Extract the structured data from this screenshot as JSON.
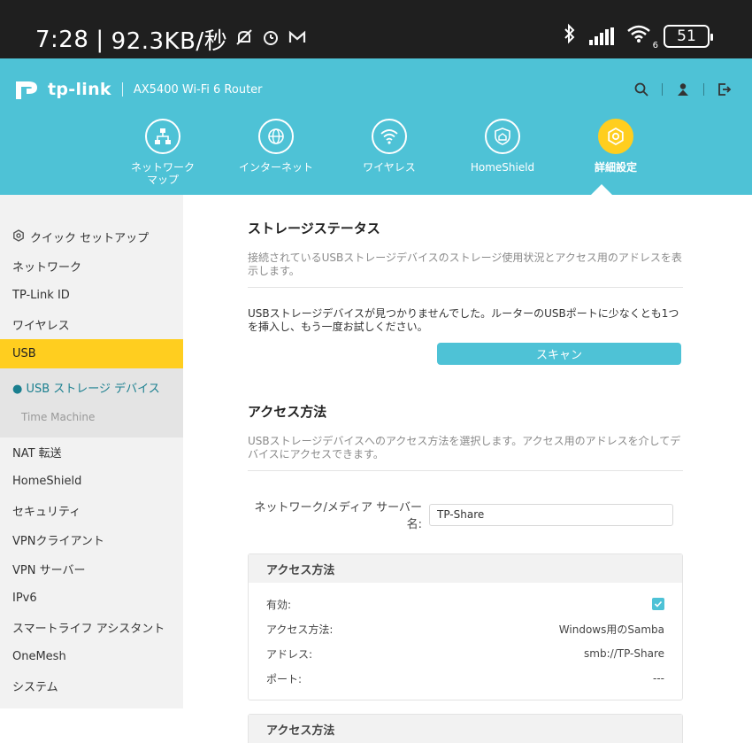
{
  "status_bar": {
    "time": "7:28",
    "speed": "92.3KB/秒",
    "battery": "51",
    "wifi_badge": "6",
    "icons": [
      "mute-icon",
      "alarm-icon",
      "mail-icon",
      "bluetooth-icon",
      "signal-icon",
      "wifi-icon",
      "battery-icon"
    ]
  },
  "header": {
    "brand": "tp-link",
    "model": "AX5400 Wi-Fi 6 Router",
    "icons": [
      "search-icon",
      "account-icon",
      "logout-icon"
    ],
    "nav": [
      {
        "label": "ネットワーク\nマップ",
        "icon": "network-map-icon"
      },
      {
        "label": "インターネット",
        "icon": "globe-icon"
      },
      {
        "label": "ワイヤレス",
        "icon": "wifi-icon"
      },
      {
        "label": "HomeShield",
        "icon": "homeshield-icon"
      },
      {
        "label": "詳細設定",
        "icon": "gear-icon"
      }
    ],
    "accent": "#4ec2d6",
    "active_color": "#ffce1f"
  },
  "sidebar": {
    "quick_setup": "クイック セットアップ",
    "items_top": [
      "ネットワーク",
      "TP-Link ID",
      "ワイヤレス"
    ],
    "active": "USB",
    "sub": [
      "● USB ストレージ デバイス",
      "Time Machine"
    ],
    "items_bottom": [
      "NAT 転送",
      "HomeShield",
      "セキュリティ",
      "VPNクライアント",
      "VPN サーバー",
      "IPv6",
      "スマートライフ アシスタント",
      "OneMesh",
      "システム"
    ]
  },
  "main": {
    "storage_title": "ストレージステータス",
    "storage_desc": "接続されているUSBストレージデバイスのストレージ使用状況とアクセス用のアドレスを表示します。",
    "notice": "USBストレージデバイスが見つかりませんでした。ルーターのUSBポートに少なくとも1つを挿入し、もう一度お試しください。",
    "scan_label": "スキャン",
    "access_title": "アクセス方法",
    "access_desc": "USBストレージデバイスへのアクセス方法を選択します。アクセス用のアドレスを介してデバイスにアクセスできます。",
    "server_label": "ネットワーク/メディア サーバー名:",
    "server_value": "TP-Share",
    "card1": {
      "title": "アクセス方法",
      "enabled_label": "有効:",
      "method_label": "アクセス方法:",
      "method_value": "Windows用のSamba",
      "address_label": "アドレス:",
      "address_value": "smb://TP-Share",
      "port_label": "ポート:",
      "port_value": "---"
    },
    "card2_title": "アクセス方法"
  }
}
